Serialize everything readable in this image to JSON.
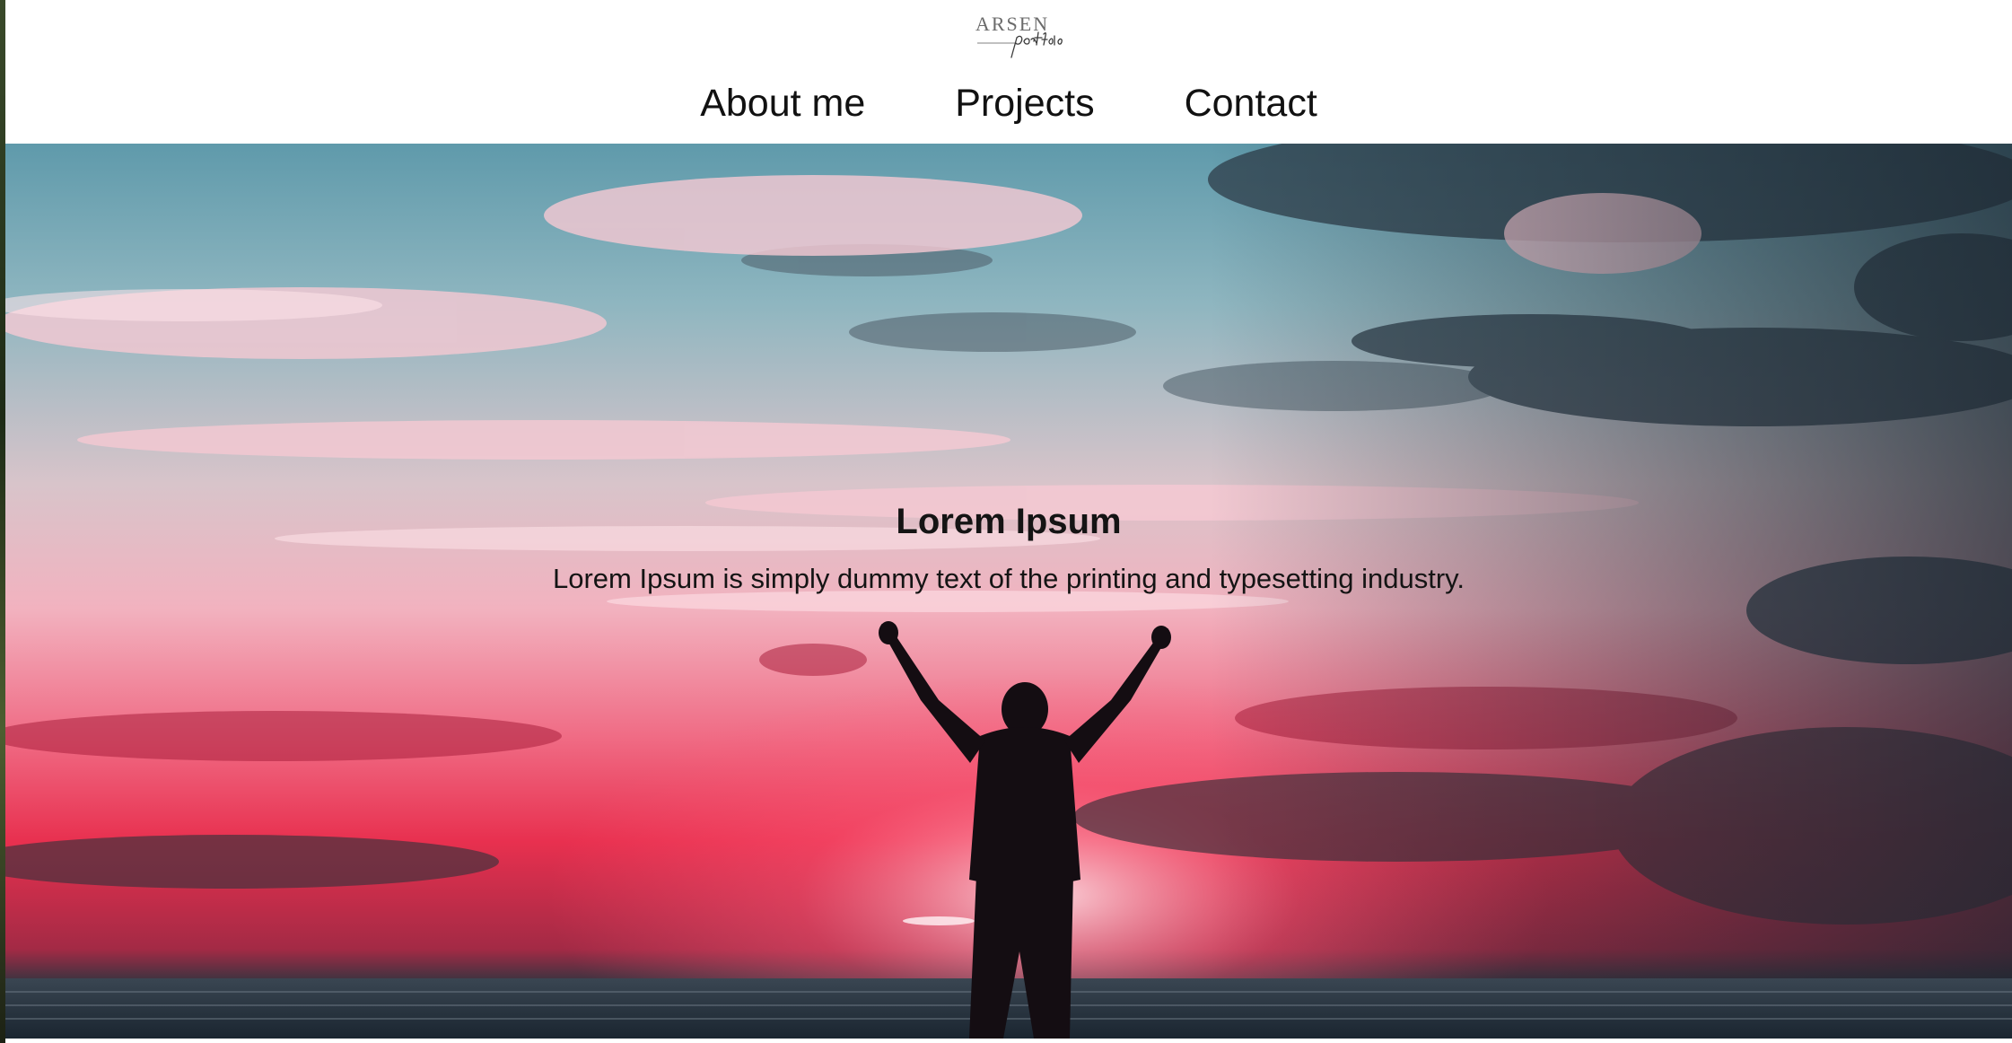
{
  "logo": {
    "wordmark": "ARSEN",
    "script": "portfolio"
  },
  "nav": {
    "items": [
      {
        "label": "About me"
      },
      {
        "label": "Projects"
      },
      {
        "label": "Contact"
      }
    ]
  },
  "hero": {
    "title": "Lorem Ipsum",
    "description": "Lorem Ipsum is simply dummy text of the printing and typesetting industry."
  },
  "colors": {
    "sky_blue": "#6fa4b2",
    "sunset_red": "#e8304f",
    "sunset_pink": "#f0a5b4",
    "sea_dark": "#1e2a35",
    "silhouette": "#140d12"
  }
}
